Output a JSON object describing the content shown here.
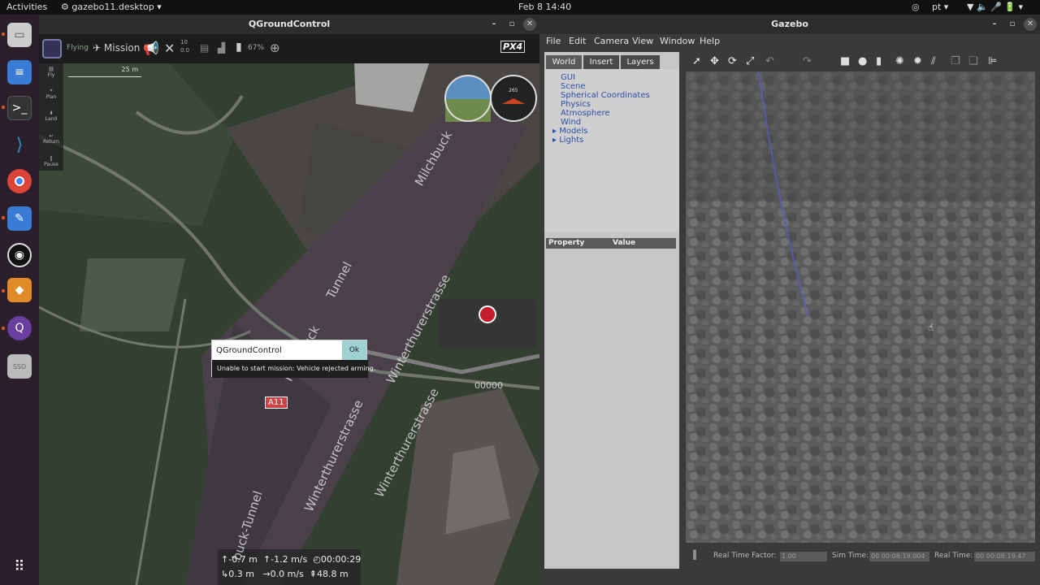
{
  "topbar": {
    "activities": "Activities",
    "app_name": "gazebo11.desktop",
    "clock": "Feb 8  14:40",
    "lang": "pt"
  },
  "dock": {
    "icons": [
      "files-icon",
      "text-editor-icon",
      "terminal-icon",
      "vscode-icon",
      "chrome-icon",
      "pencil-icon",
      "obs-icon",
      "gazebo-icon",
      "qgc-icon",
      "ssd-icon",
      "apps-grid-icon"
    ],
    "ssd_label": "SSD"
  },
  "qgc": {
    "title": "QGroundControl",
    "toolbar": {
      "flight_mode": "Flying",
      "mission": "Mission",
      "sats_top": "10",
      "sats_bottom": "0.0",
      "battery": "67%",
      "brand": "PX4"
    },
    "left_tools": [
      "Fly",
      "Plan",
      "Land",
      "Return",
      "Pause"
    ],
    "scale": "25 m",
    "compass_heading": "265",
    "map_labels": [
      "Milchbuck",
      "Tunnel",
      "Winterthurerstrasse",
      "Milchbuck",
      "Winterthurerstrasse",
      "Winterthurerstrasse",
      "buck-Tunnel",
      "A11"
    ],
    "record_time": "00000",
    "dialog": {
      "title": "QGroundControl",
      "ok": "Ok",
      "message": "Unable to start mission: Vehicle rejected arming."
    },
    "telemetry": {
      "alt": "-0.7 m",
      "vspeed": "-1.2 m/s",
      "time": "00:00:29",
      "dist": "0.3 m",
      "hspeed": "0.0 m/s",
      "home": "48.8 m"
    }
  },
  "gazebo": {
    "title": "Gazebo",
    "menu": [
      "File",
      "Edit",
      "Camera",
      "View",
      "Window",
      "Help"
    ],
    "tabs": [
      "World",
      "Insert",
      "Layers"
    ],
    "tree": [
      "GUI",
      "Scene",
      "Spherical Coordinates",
      "Physics",
      "Atmosphere",
      "Wind",
      "Models",
      "Lights"
    ],
    "prop_header": {
      "property": "Property",
      "value": "Value"
    },
    "status": {
      "rtf_label": "Real Time Factor:",
      "rtf": "1.00",
      "sim_label": "Sim Time:",
      "sim": "00 00:08:19.004",
      "real_label": "Real Time:",
      "real": "00 00:08:19.47"
    }
  }
}
